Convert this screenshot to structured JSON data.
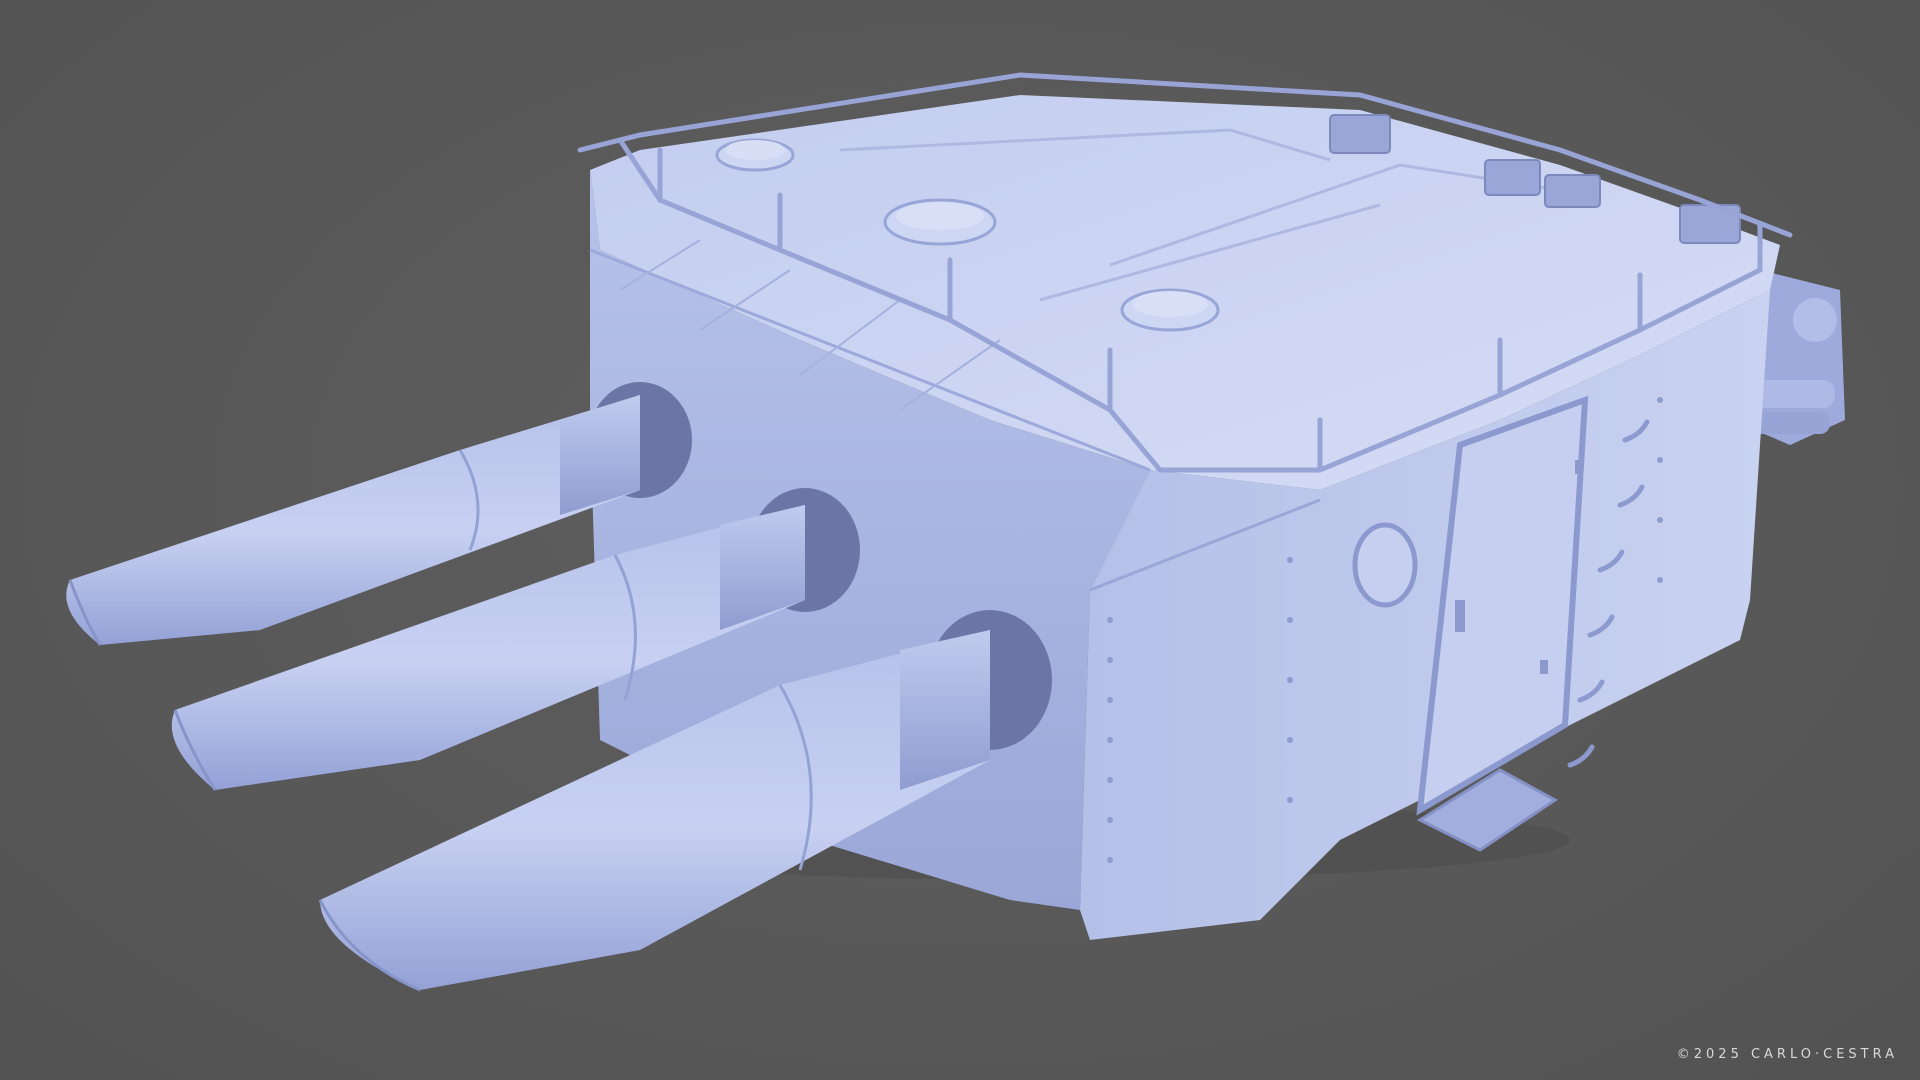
{
  "image": {
    "subject": "turret",
    "palette": {
      "background": "#5a5a5a",
      "model_light": "#c7d1ef",
      "model_mid": "#a9b6e2",
      "model_dark": "#8895c8",
      "model_shadow": "#6f7aac",
      "credit_text": "#d9d9d9"
    }
  },
  "watermark": {
    "text": "©2025 CARLO·CESTRA"
  }
}
